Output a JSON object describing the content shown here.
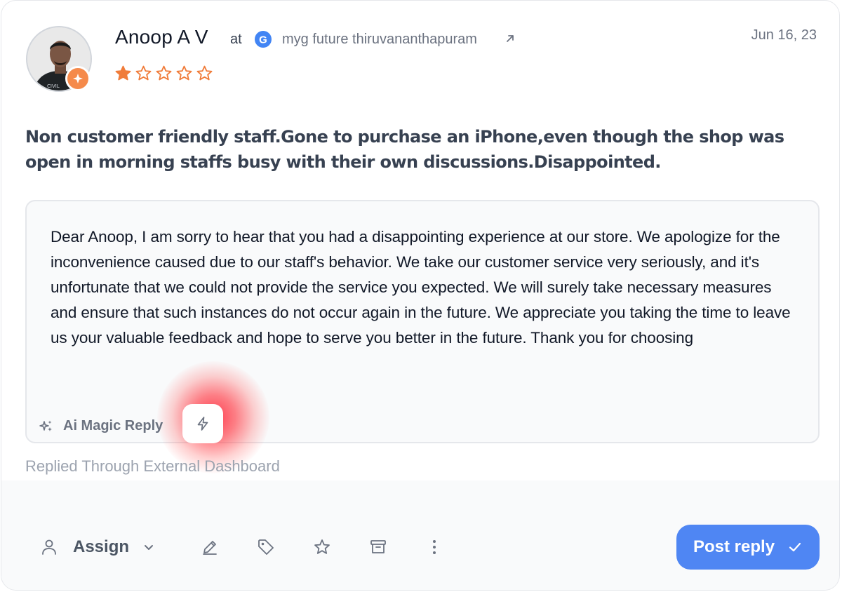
{
  "review": {
    "reviewer_name": "Anoop A V",
    "at_text": "at",
    "source_icon": "google-icon",
    "location": "myg future thiruvananthapuram",
    "date": "Jun 16, 23",
    "rating": 1,
    "rating_max": 5,
    "star_color": "#f07c3a",
    "text": "Non customer friendly staff.Gone to purchase an iPhone,even though the shop was open in morning staffs busy with their own discussions.Disappointed."
  },
  "reply": {
    "text": "Dear Anoop, I am sorry to hear that you had a disappointing experience at our store. We apologize for the inconvenience caused due to our staff's behavior. We take our customer service very seriously, and it's unfortunate that we could not provide the service you expected. We will surely take necessary measures and ensure that such instances do not occur again in the future. We appreciate you taking the time to leave us your valuable feedback and hope to serve you better in the future. Thank you for choosing",
    "ai_label": "Ai Magic Reply",
    "ai_icon": "sparkles-icon",
    "bolt_icon": "lightning-bolt-icon",
    "status": "Replied Through External Dashboard"
  },
  "footer": {
    "assign_label": "Assign",
    "tools": [
      "user-icon",
      "chevron-down-icon",
      "pencil-icon",
      "tag-icon",
      "star-outline-icon",
      "archive-icon",
      "more-vertical-icon"
    ],
    "post_reply_label": "Post reply",
    "accent_color": "#4f86f3"
  }
}
